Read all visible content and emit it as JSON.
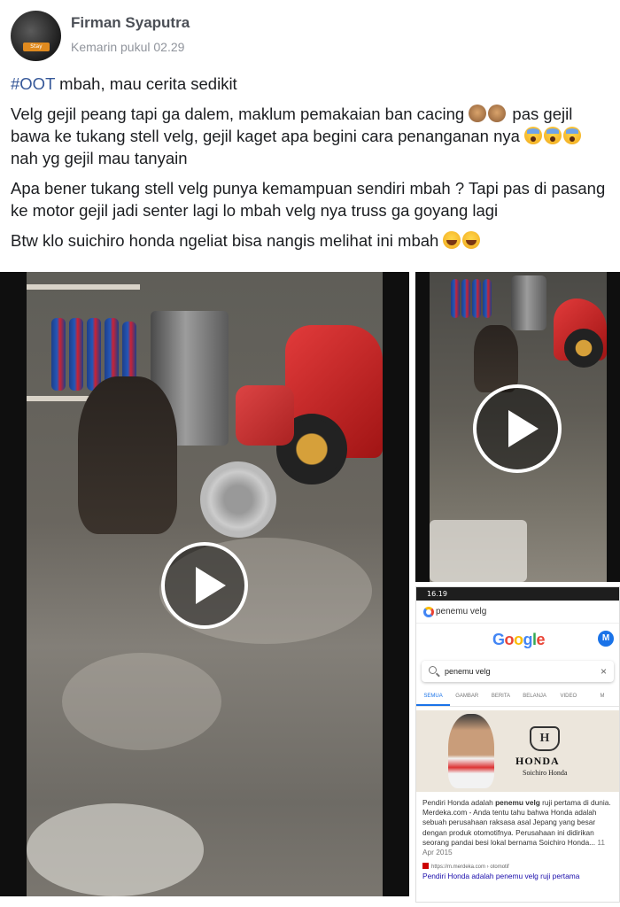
{
  "post": {
    "author": "Firman Syaputra",
    "timestamp": "Kemarin pukul 02.29",
    "avatar_badge": "Stay",
    "hashtag": "#OOT",
    "line1": " mbah, mau cerita sedikit",
    "para2a": "Velg gejil peang tapi ga dalem, maklum pemakaian ban cacing ",
    "para2b": " pas gejil bawa ke tukang stell velg, gejil kaget apa begini cara penanganan nya ",
    "para2c": " nah yg gejil mau tanyain",
    "para3": "Apa bener tukang stell velg punya kemampuan sendiri mbah ? Tapi pas di pasang ke motor gejil jadi senter lagi lo mbah velg nya truss ga goyang lagi",
    "para4": "Btw klo suichiro honda ngeliat bisa nangis melihat ini mbah "
  },
  "screenshot": {
    "status_time": "16.19",
    "url_text": "penemu velg",
    "logo_letters": [
      "G",
      "o",
      "o",
      "g",
      "l",
      "e"
    ],
    "account_initial": "M",
    "search_query": "penemu velg",
    "clear_icon": "×",
    "tabs": [
      "SEMUA",
      "GAMBAR",
      "BERITA",
      "BELANJA",
      "VIDEO",
      "M"
    ],
    "honda_emblem": "H",
    "honda_word": "HONDA",
    "honda_sub": "Soichiro Honda",
    "snippet_pre": "Pendiri Honda adalah ",
    "snippet_bold": "penemu velg",
    "snippet_post": " ruji pertama di dunia. Merdeka.com - Anda tentu tahu bahwa Honda adalah sebuah perusahaan raksasa asal Jepang yang besar dengan produk otomotifnya. Perusahaan ini didirikan seorang pandai besi lokal bernama Soichiro Honda... ",
    "snippet_date": "11 Apr 2015",
    "source_url": "https://m.merdeka.com › otomotif",
    "result_title": "Pendiri Honda adalah penemu velg ruji pertama"
  },
  "icons": {
    "play": "play-icon",
    "emoji_see_no_evil": "see-no-evil-monkey-emoji",
    "emoji_scream": "screaming-face-emoji",
    "emoji_laugh": "rolling-laughing-emoji"
  },
  "colors": {
    "hashtag": "#365899",
    "name": "#4b4f56",
    "timestamp": "#90949c",
    "google_blue": "#1a73e8",
    "link": "#1a0dab"
  }
}
